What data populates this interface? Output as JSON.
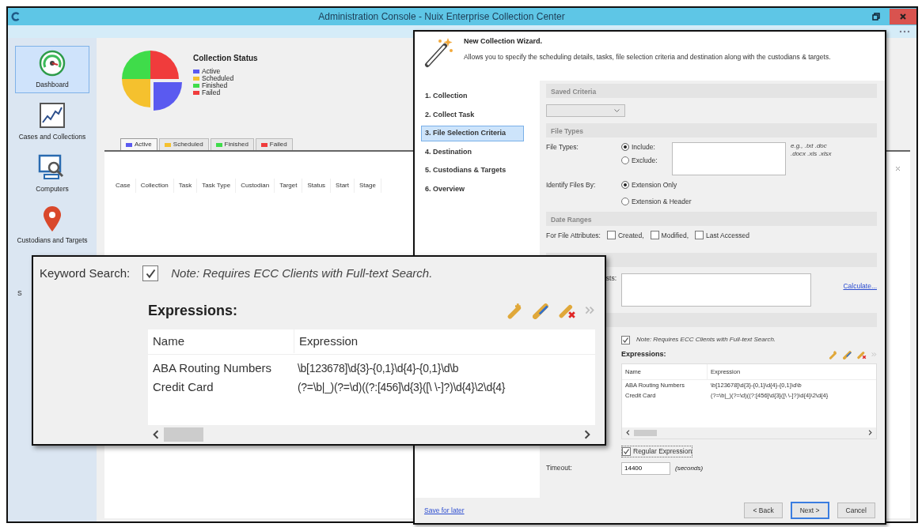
{
  "window": {
    "title": "Administration Console - Nuix Enterprise Collection Center"
  },
  "sidebar": {
    "items": [
      {
        "label": "Dashboard",
        "kind": "gauge",
        "selected": true
      },
      {
        "label": "Cases and Collections",
        "kind": "chart",
        "selected": false
      },
      {
        "label": "Computers",
        "kind": "computer",
        "selected": false
      },
      {
        "label": "Custodians and Targets",
        "kind": "pin",
        "selected": false
      },
      {
        "label": "S",
        "kind": "hidden",
        "selected": false
      }
    ]
  },
  "dashboard": {
    "chart_title": "Collection Status",
    "legend": [
      {
        "label": "Active",
        "color": "#5a5af0"
      },
      {
        "label": "Scheduled",
        "color": "#f5c12e"
      },
      {
        "label": "Finished",
        "color": "#3fdc4a"
      },
      {
        "label": "Failed",
        "color": "#f03c3c"
      }
    ],
    "tabs": [
      {
        "label": "Active",
        "color": "#5a5af0",
        "selected": true
      },
      {
        "label": "Scheduled",
        "color": "#f5c12e",
        "selected": false
      },
      {
        "label": "Finished",
        "color": "#3fdc4a",
        "selected": false
      },
      {
        "label": "Failed",
        "color": "#f03c3c",
        "selected": false
      }
    ],
    "table": {
      "columns": [
        "Case",
        "Collection",
        "Task",
        "Task Type",
        "Custodian",
        "Target",
        "Status",
        "Start",
        "Stage"
      ]
    }
  },
  "wizard": {
    "title": "New Collection Wizard.",
    "description": "Allows you to specify the scheduling details, tasks, file selection criteria and destination along with the custodians & targets.",
    "steps": [
      {
        "label": "1. Collection",
        "selected": false
      },
      {
        "label": "2. Collect Task",
        "selected": false
      },
      {
        "label": "3. File Selection Criteria",
        "selected": true
      },
      {
        "label": "4. Destination",
        "selected": false
      },
      {
        "label": "5. Custodians & Targets",
        "selected": false
      },
      {
        "label": "6. Overview",
        "selected": false
      }
    ],
    "saved_criteria": {
      "heading": "Saved Criteria"
    },
    "file_types": {
      "heading": "File Types",
      "label": "File Types:",
      "options": [
        {
          "label": "Include:",
          "selected": true
        },
        {
          "label": "Exclude:",
          "selected": false
        }
      ],
      "hint": "e.g., .txt .doc .docx .xls .xlsx"
    },
    "identify": {
      "label": "Identify Files By:",
      "options": [
        {
          "label": "Extension Only",
          "selected": true
        },
        {
          "label": "Extension & Header",
          "selected": false
        }
      ]
    },
    "date_ranges": {
      "heading": "Date Ranges",
      "label": "For File Attributes:",
      "options": [
        {
          "label": "Created,",
          "checked": false
        },
        {
          "label": "Modified,",
          "checked": false
        },
        {
          "label": "Last Accessed",
          "checked": false
        }
      ]
    },
    "limits": {
      "label": "sts:",
      "link": "Calculate..."
    },
    "keyword_search": {
      "checked": true,
      "note": "Note: Requires ECC Clients with Full-text Search."
    },
    "expressions": {
      "heading": "Expressions:",
      "columns": [
        "Name",
        "Expression"
      ],
      "rows": [
        {
          "name": "ABA Routing Numbers",
          "expression": "\\b[123678]\\d{3}-{0,1}\\d{4}-{0,1}\\d\\b"
        },
        {
          "name": "Credit Card",
          "expression": "(?=\\b|_)(?=\\d)((?:[456]\\d{3}([\\ \\-]?)\\d{4}\\2\\d{4}"
        }
      ]
    },
    "regular_expression": {
      "label": "Regular Expression",
      "checked": true
    },
    "timeout": {
      "label": "Timeout:",
      "value": "14400",
      "unit": "(seconds)"
    },
    "footer": {
      "link": "Save for later",
      "buttons": [
        {
          "label": "< Back",
          "focused": false
        },
        {
          "label": "Next >",
          "focused": true
        },
        {
          "label": "Cancel",
          "focused": false
        }
      ]
    }
  },
  "callout": {
    "label": "Keyword Search:",
    "checked": true,
    "note": "Note: Requires ECC Clients with Full-text Search.",
    "expressions": {
      "heading": "Expressions:",
      "columns": [
        "Name",
        "Expression"
      ],
      "rows": [
        {
          "name": "ABA Routing Numbers",
          "expression": "\\b[123678]\\d{3}-{0,1}\\d{4}-{0,1}\\d\\b"
        },
        {
          "name": "Credit Card",
          "expression": "(?=\\b|_)(?=\\d)((?:[456]\\d{3}([\\ \\-]?)\\d{4}\\2\\d{4}"
        }
      ]
    }
  }
}
